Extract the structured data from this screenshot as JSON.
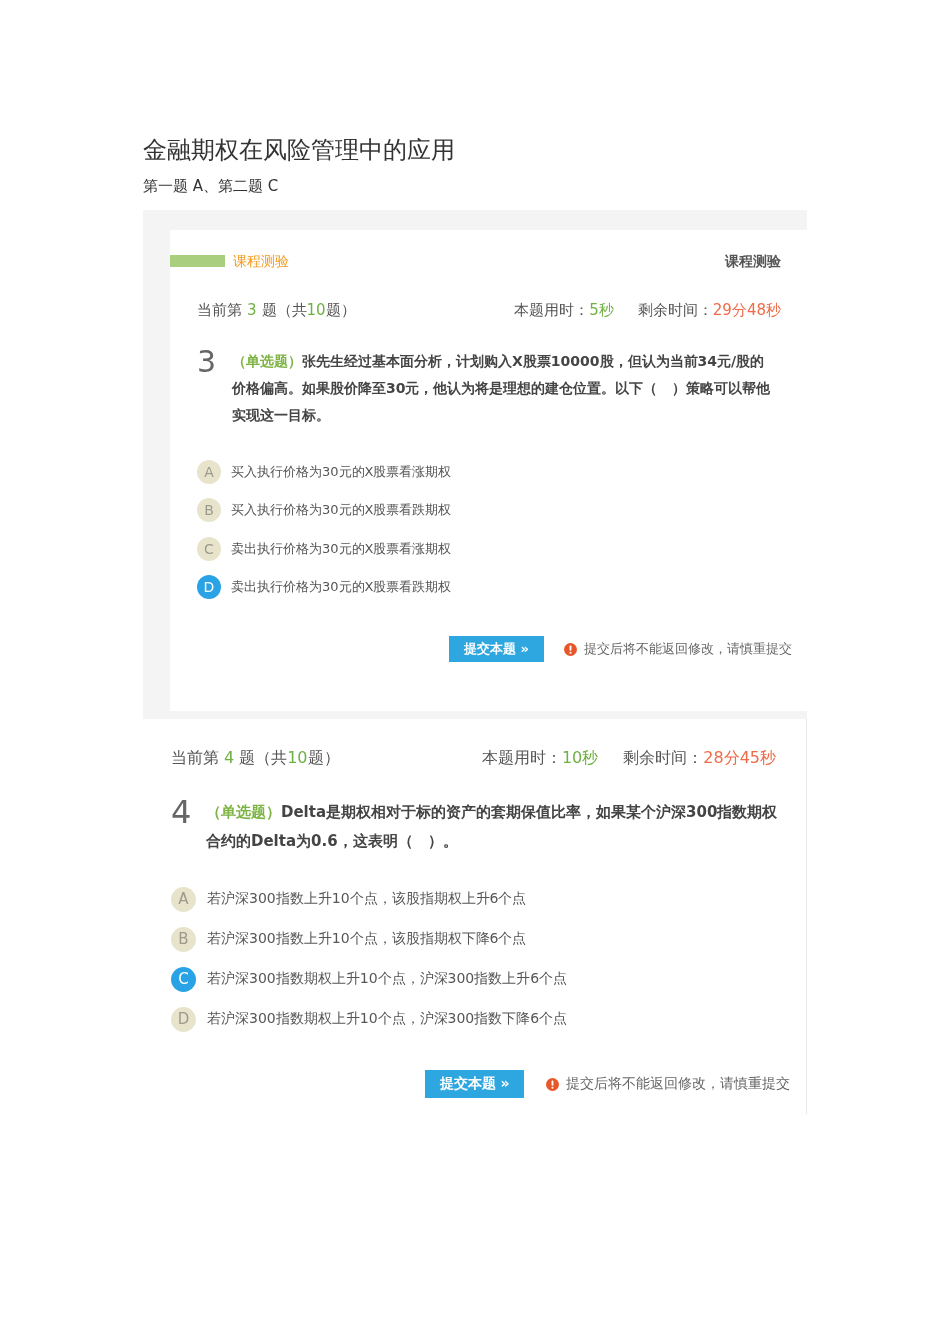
{
  "document": {
    "title": "金融期权在风险管理中的应用",
    "answer_note": "第一题 A、第二题 C"
  },
  "screenshots": [
    {
      "kind": "framed",
      "header": {
        "tab_label": "课程测验",
        "title": "课程测验"
      },
      "progress": {
        "before": "当前第",
        "current": "3",
        "middle": "题（共",
        "total": "10",
        "after": "题）"
      },
      "time_used": {
        "label": "本题用时：",
        "value": "5秒"
      },
      "time_left": {
        "label": "剩余时间：",
        "value": "29分48秒"
      },
      "question": {
        "number": "3",
        "type_label": "（单选题）",
        "text": "张先生经过基本面分析，计划购入X股票10000股，但认为当前34元/股的价格偏高。如果股价降至30元，他认为将是理想的建仓位置。以下（   ）策略可以帮他实现这一目标。"
      },
      "options": [
        {
          "letter": "A",
          "text": "买入执行价格为30元的X股票看涨期权",
          "selected": false
        },
        {
          "letter": "B",
          "text": "买入执行价格为30元的X股票看跌期权",
          "selected": false
        },
        {
          "letter": "C",
          "text": "卖出执行价格为30元的X股票看涨期权",
          "selected": false
        },
        {
          "letter": "D",
          "text": "卖出执行价格为30元的X股票看跌期权",
          "selected": true
        }
      ],
      "submit_button": "提交本题 »",
      "warning": "提交后将不能返回修改，请慎重提交"
    },
    {
      "kind": "plain",
      "progress": {
        "before": "当前第",
        "current": "4",
        "middle": "题（共",
        "total": "10",
        "after": "题）"
      },
      "time_used": {
        "label": "本题用时：",
        "value": "10秒"
      },
      "time_left": {
        "label": "剩余时间：",
        "value": "28分45秒"
      },
      "question": {
        "number": "4",
        "type_label": "（单选题）",
        "text": "Delta是期权相对于标的资产的套期保值比率，如果某个沪深300指数期权合约的Delta为0.6，这表明（   ）。"
      },
      "options": [
        {
          "letter": "A",
          "text": "若沪深300指数上升10个点，该股指期权上升6个点",
          "selected": false
        },
        {
          "letter": "B",
          "text": "若沪深300指数上升10个点，该股指期权下降6个点",
          "selected": false
        },
        {
          "letter": "C",
          "text": "若沪深300指数期权上升10个点，沪深300指数上升6个点",
          "selected": true
        },
        {
          "letter": "D",
          "text": "若沪深300指数期权上升10个点，沪深300指数下降6个点",
          "selected": false
        }
      ],
      "submit_button": "提交本题 »",
      "warning": "提交后将不能返回修改，请慎重提交"
    }
  ]
}
